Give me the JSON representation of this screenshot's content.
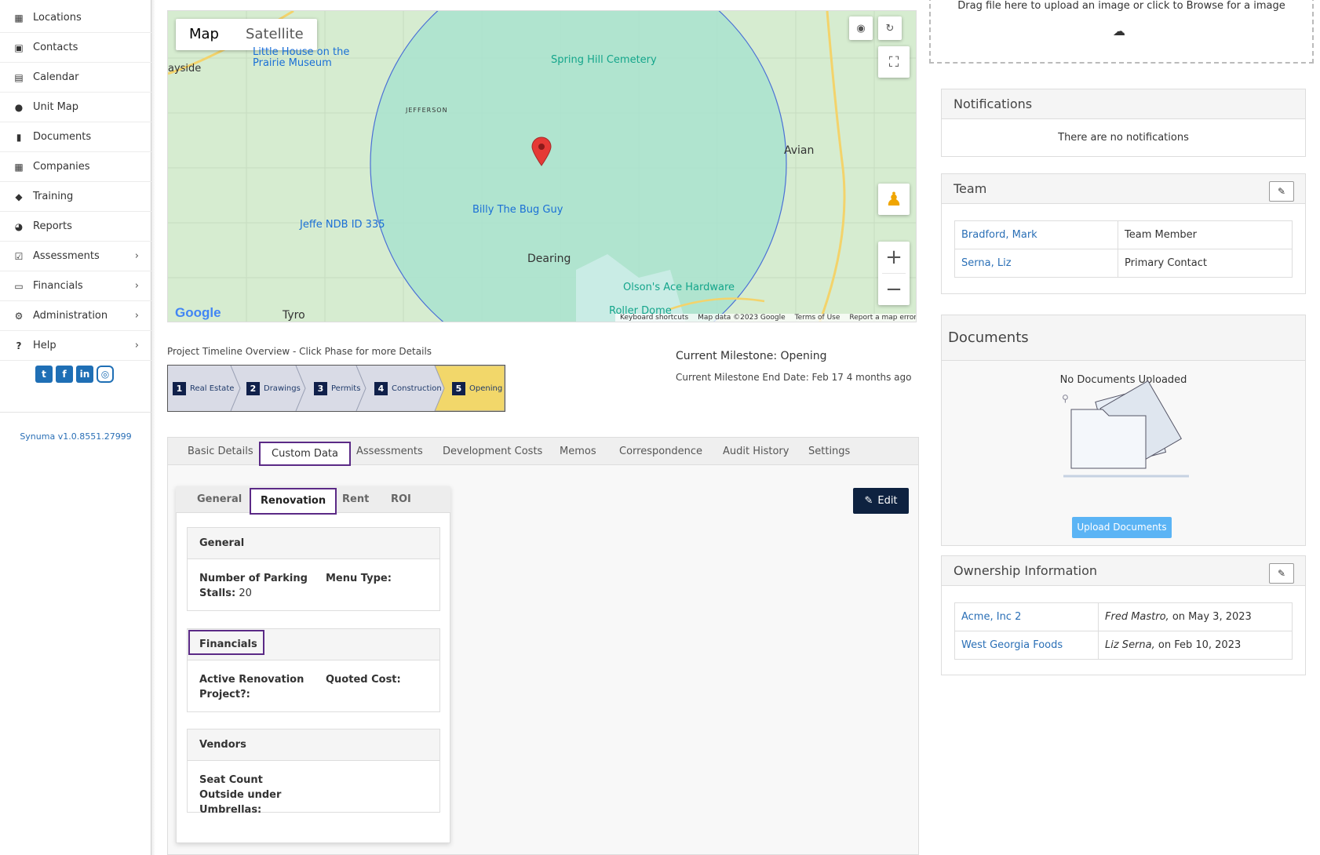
{
  "sidebar": {
    "items": [
      {
        "label": "Locations",
        "icon": "building-icon",
        "has_arrow": false
      },
      {
        "label": "Contacts",
        "icon": "contact-book-icon",
        "has_arrow": false
      },
      {
        "label": "Calendar",
        "icon": "calendar-icon",
        "has_arrow": false
      },
      {
        "label": "Unit Map",
        "icon": "globe-icon",
        "has_arrow": false
      },
      {
        "label": "Documents",
        "icon": "document-icon",
        "has_arrow": false
      },
      {
        "label": "Companies",
        "icon": "building-icon",
        "has_arrow": false
      },
      {
        "label": "Training",
        "icon": "graduation-cap-icon",
        "has_arrow": false
      },
      {
        "label": "Reports",
        "icon": "pie-chart-icon",
        "has_arrow": false
      },
      {
        "label": "Assessments",
        "icon": "checkbox-icon",
        "has_arrow": true
      },
      {
        "label": "Financials",
        "icon": "money-icon",
        "has_arrow": true
      },
      {
        "label": "Administration",
        "icon": "cogs-icon",
        "has_arrow": true
      },
      {
        "label": "Help",
        "icon": "question-icon",
        "has_arrow": true
      }
    ],
    "social": [
      "twitter-icon",
      "facebook-icon",
      "linkedin-icon",
      "instagram-icon"
    ],
    "version": "Synuma v1.0.8551.27999"
  },
  "map": {
    "type_map": "Map",
    "type_satellite": "Satellite",
    "places": {
      "little_house": "Little House on the Prairie Museum",
      "spring_hill": "Spring Hill Cemetery",
      "billy": "Billy The Bug Guy",
      "jeffe": "Jeffe NDB ID 335",
      "dearing": "Dearing",
      "olsons": "Olson's Ace Hardware",
      "avian": "Avian",
      "tyro": "Tyro",
      "jefferson": "JEFFERSON",
      "ayside": "ayside",
      "roller": "Roller Dome"
    },
    "footer": {
      "shortcuts": "Keyboard shortcuts",
      "data": "Map data ©2023 Google",
      "terms": "Terms of Use",
      "report": "Report a map error"
    },
    "google": "Google"
  },
  "timeline": {
    "title": "Project Timeline Overview - Click Phase for more Details",
    "phases": [
      {
        "num": "1",
        "label": "Real Estate"
      },
      {
        "num": "2",
        "label": "Drawings"
      },
      {
        "num": "3",
        "label": "Permits"
      },
      {
        "num": "4",
        "label": "Construction"
      },
      {
        "num": "5",
        "label": "Opening"
      }
    ],
    "milestone": "Current Milestone: Opening",
    "milestone_end": "Current Milestone End Date: Feb 17 4 months ago"
  },
  "tabs": [
    "Basic Details",
    "Custom Data",
    "Assessments",
    "Development Costs",
    "Memos",
    "Correspondence",
    "Audit History",
    "Settings"
  ],
  "subtabs": [
    "General",
    "Renovation",
    "Rent",
    "ROI"
  ],
  "edit_label": "Edit",
  "cards": {
    "general": {
      "title": "General",
      "parking_label": "Number of Parking Stalls:",
      "parking_value": " 20",
      "menu_label": "Menu Type:"
    },
    "financials": {
      "title": "Financials",
      "active_label": "Active Renovation Project?:",
      "quoted_label": "Quoted Cost:"
    },
    "vendors": {
      "title": "Vendors",
      "seat_label": "Seat Count Outside under Umbrellas:"
    }
  },
  "upload": {
    "text": "Drag file here to upload an image or click to Browse for a image"
  },
  "notifications": {
    "title": "Notifications",
    "empty": "There are no notifications"
  },
  "team": {
    "title": "Team",
    "rows": [
      {
        "name": "Bradford, Mark",
        "role": "Team Member"
      },
      {
        "name": "Serna, Liz",
        "role": "Primary Contact"
      }
    ]
  },
  "documents": {
    "title": "Documents",
    "empty": "No Documents Uploaded",
    "upload_btn": "Upload Documents"
  },
  "ownership": {
    "title": "Ownership Information",
    "rows": [
      {
        "company": "Acme, Inc 2",
        "by": "Fred Mastro,",
        "date": " on May 3, 2023"
      },
      {
        "company": "West Georgia Foods",
        "by": "Liz Serna,",
        "date": " on Feb 10, 2023"
      }
    ]
  }
}
